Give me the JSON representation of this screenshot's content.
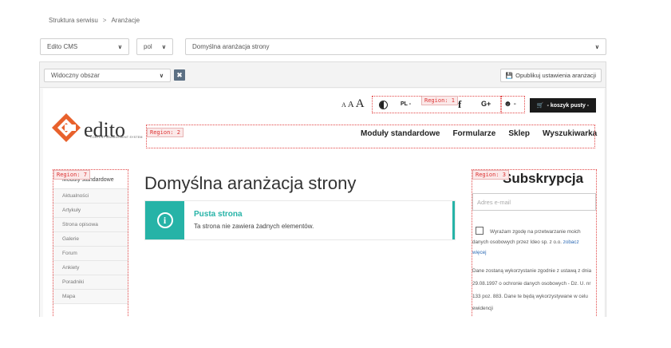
{
  "breadcrumb": {
    "root": "Struktura serwisu",
    "separator": ">",
    "current": "Aranżacje"
  },
  "selectors": {
    "cms": "Edito CMS",
    "lang": "pol",
    "arrangement": "Domyślna aranżacja strony"
  },
  "toolbar": {
    "view_select": "Widoczny obszar",
    "publish_label": "Opublikuj ustawienia aranżacji"
  },
  "regions": {
    "r1": "Region: 1",
    "r2": "Region: 2",
    "r3": "Region: 3",
    "r7": "Region: 7"
  },
  "header": {
    "logo_text": "edito",
    "logo_sub": "CONTENT MANAGEMENT SYSTEM",
    "font_small": "A",
    "font_medium": "A",
    "font_large": "A",
    "lang": "PL -",
    "facebook": "f",
    "gplus": "G+",
    "user_caret": "-",
    "cart_label": "- koszyk pusty -"
  },
  "nav": [
    "Moduły standardowe",
    "Formularze",
    "Sklep",
    "Wyszukiwarka"
  ],
  "sidebar": {
    "title": "Moduły standardowe",
    "items": [
      "Aktualności",
      "Artykuły",
      "Strona opisowa",
      "Galerie",
      "Forum",
      "Ankiety",
      "Poradniki",
      "Mapa"
    ]
  },
  "main": {
    "title": "Domyślna aranżacja strony",
    "alert_title": "Pusta strona",
    "alert_text": "Ta strona nie zawiera żadnych elementów."
  },
  "subscription": {
    "title": "Subskrypcja",
    "email_placeholder": "Adres e-mail",
    "consent_text": "Wyrażam zgodę na przetwarzanie moich danych osobowych przez Ideo sp. z o.o.",
    "consent_more": "zobacz więcej",
    "info_text": "Dane zostaną wykorzystanie zgodnie z ustawą z dnia 29.08.1997 o ochronie danych osobowych - Dz. U. nr 133 poz. 883. Dane te będą wykorzystywane w celu ewidencji"
  },
  "colors": {
    "accent": "#26b3a7",
    "logo_orange": "#e8612c",
    "region": "#e34848"
  }
}
